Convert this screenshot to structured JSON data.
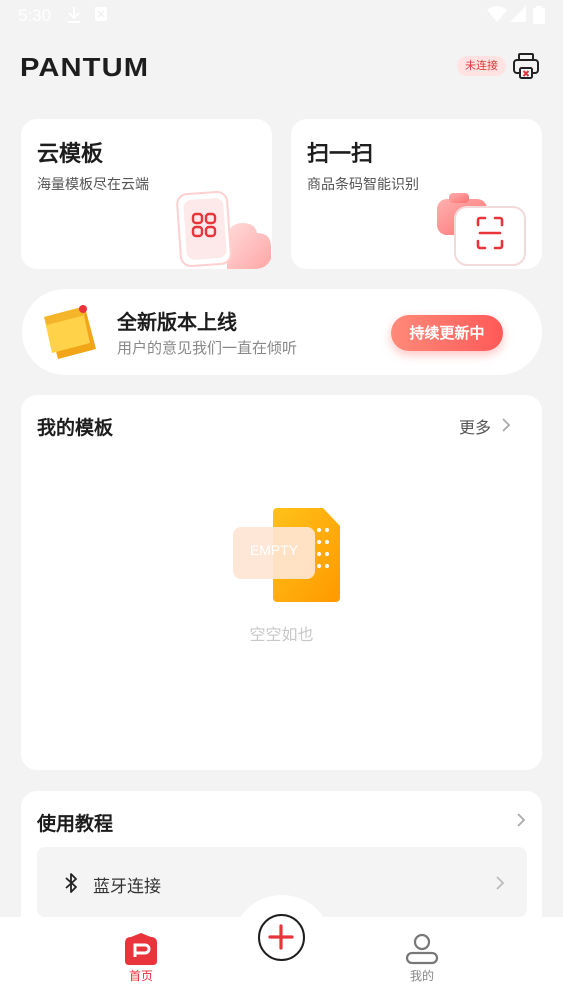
{
  "status_bar": {
    "time": "5:30"
  },
  "header": {
    "logo": "PANTUM",
    "connection_status": "未连接"
  },
  "cards": [
    {
      "title": "云模板",
      "subtitle": "海量模板尽在云端"
    },
    {
      "title": "扫一扫",
      "subtitle": "商品条码智能识别"
    }
  ],
  "banner": {
    "title": "全新版本上线",
    "subtitle": "用户的意见我们一直在倾听",
    "button_label": "持续更新中"
  },
  "my_templates": {
    "title": "我的模板",
    "more_label": "更多",
    "empty_badge": "EMPTY",
    "empty_text": "空空如也"
  },
  "tutorial": {
    "title": "使用教程",
    "items": [
      {
        "label": "蓝牙连接"
      }
    ]
  },
  "tabbar": {
    "home_label": "首页",
    "mine_label": "我的"
  },
  "colors": {
    "accent": "#e8343a",
    "background": "#f3f3f3"
  }
}
